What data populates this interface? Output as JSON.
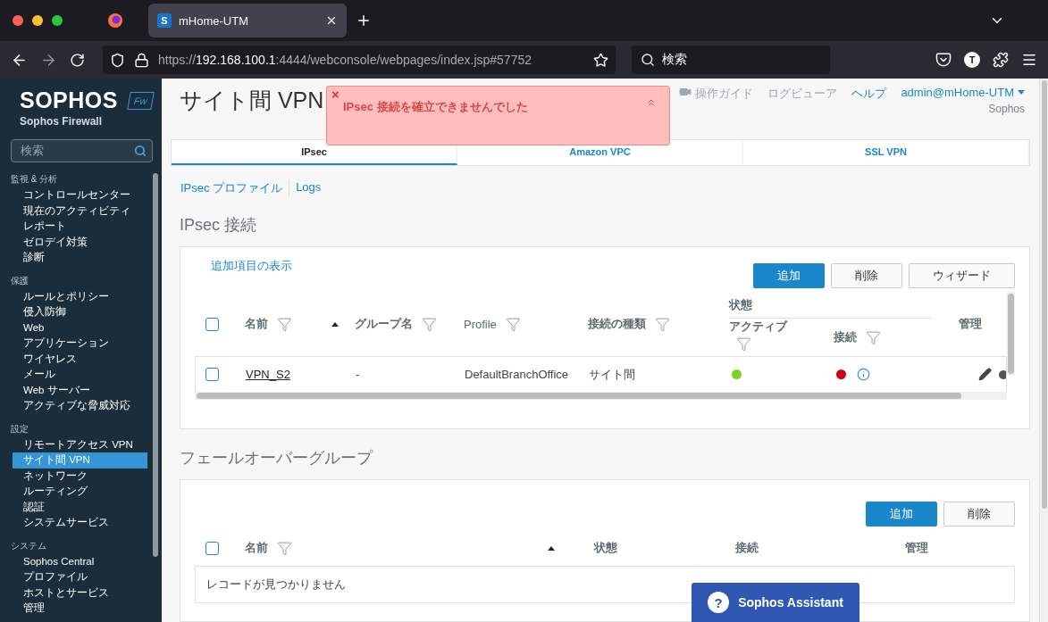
{
  "browser": {
    "favicon": "S",
    "tab_title": "mHome-UTM",
    "url_prefix": "https://",
    "url_host": "192.168.100.1",
    "url_rest": ":4444/webconsole/webpages/index.jsp#57752",
    "search_placeholder": "検索",
    "profile_initial": "T"
  },
  "sidebar": {
    "brand": "SOPHOS",
    "badge": "Fw",
    "product": "Sophos Firewall",
    "search_placeholder": "検索",
    "sections": [
      {
        "title": "監視 & 分析",
        "items": [
          {
            "label": "コントロールセンター",
            "selected": false
          },
          {
            "label": "現在のアクティビティ",
            "selected": false
          },
          {
            "label": "レポート",
            "selected": false
          },
          {
            "label": "ゼロデイ対策",
            "selected": false
          },
          {
            "label": "診断",
            "selected": false
          }
        ]
      },
      {
        "title": "保護",
        "items": [
          {
            "label": "ルールとポリシー",
            "selected": false
          },
          {
            "label": "侵入防御",
            "selected": false
          },
          {
            "label": "Web",
            "selected": false
          },
          {
            "label": "アプリケーション",
            "selected": false
          },
          {
            "label": "ワイヤレス",
            "selected": false
          },
          {
            "label": "メール",
            "selected": false
          },
          {
            "label": "Web サーバー",
            "selected": false
          },
          {
            "label": "アクティブな脅威対応",
            "selected": false
          }
        ]
      },
      {
        "title": "設定",
        "items": [
          {
            "label": "リモートアクセス VPN",
            "selected": false
          },
          {
            "label": "サイト間 VPN",
            "selected": true
          },
          {
            "label": "ネットワーク",
            "selected": false
          },
          {
            "label": "ルーティング",
            "selected": false
          },
          {
            "label": "認証",
            "selected": false
          },
          {
            "label": "システムサービス",
            "selected": false
          }
        ]
      },
      {
        "title": "システム",
        "items": [
          {
            "label": "Sophos Central",
            "selected": false
          },
          {
            "label": "プロファイル",
            "selected": false
          },
          {
            "label": "ホストとサービス",
            "selected": false
          },
          {
            "label": "管理",
            "selected": false
          }
        ]
      }
    ]
  },
  "header": {
    "title": "サイト間 VPN",
    "links": [
      "操作ガイド",
      "ログビューア",
      "ヘルプ"
    ],
    "user": "admin@mHome-UTM",
    "org": "Sophos"
  },
  "toast": {
    "message": "IPsec 接続を確立できませんでした",
    "close": "×"
  },
  "tabs": [
    {
      "label": "IPsec",
      "selected": true
    },
    {
      "label": "Amazon VPC",
      "selected": false
    },
    {
      "label": "SSL VPN",
      "selected": false
    }
  ],
  "sublinks": [
    "IPsec プロファイル",
    "Logs"
  ],
  "ipsec": {
    "title": "IPsec 接続",
    "show_more": "追加項目の表示",
    "select_all": false,
    "buttons": [
      "追加",
      "削除",
      "ウィザード"
    ],
    "columns": {
      "name": "名前",
      "group": "グループ名",
      "profile": "Profile",
      "type": "接続の種類",
      "status": "状態",
      "active": "アクティブ",
      "connection": "接続",
      "manage": "管理"
    },
    "rows": [
      {
        "checked": false,
        "name": "VPN_S2",
        "group": "-",
        "profile": "DefaultBranchOffice",
        "type": "サイト間",
        "active": true,
        "connected": false
      }
    ]
  },
  "failover": {
    "title": "フェールオーバーグループ",
    "select_all": false,
    "buttons": [
      "追加",
      "削除"
    ],
    "columns": {
      "name": "名前",
      "status": "状態",
      "connection": "接続",
      "manage": "管理"
    },
    "empty": "レコードが見つかりません"
  },
  "assistant": {
    "icon": "?",
    "label": "Sophos Assistant"
  }
}
